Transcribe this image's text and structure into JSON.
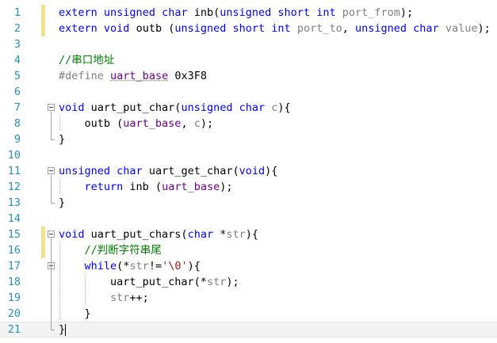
{
  "editor": {
    "language": "C",
    "current_line": 21,
    "lines": [
      {
        "n": "1",
        "tokens": [
          {
            "t": "extern",
            "c": "kw"
          },
          {
            "t": " ",
            "c": ""
          },
          {
            "t": "unsigned",
            "c": "kw"
          },
          {
            "t": " ",
            "c": ""
          },
          {
            "t": "char",
            "c": "kw"
          },
          {
            "t": " inb(",
            "c": ""
          },
          {
            "t": "unsigned",
            "c": "kw"
          },
          {
            "t": " ",
            "c": ""
          },
          {
            "t": "short",
            "c": "kw"
          },
          {
            "t": " ",
            "c": ""
          },
          {
            "t": "int",
            "c": "kw"
          },
          {
            "t": " ",
            "c": ""
          },
          {
            "t": "port_from",
            "c": "pm"
          },
          {
            "t": ");",
            "c": ""
          }
        ]
      },
      {
        "n": "2",
        "tokens": [
          {
            "t": "extern",
            "c": "kw"
          },
          {
            "t": " ",
            "c": ""
          },
          {
            "t": "void",
            "c": "kw"
          },
          {
            "t": " outb (",
            "c": ""
          },
          {
            "t": "unsigned",
            "c": "kw"
          },
          {
            "t": " ",
            "c": ""
          },
          {
            "t": "short",
            "c": "kw"
          },
          {
            "t": " ",
            "c": ""
          },
          {
            "t": "int",
            "c": "kw"
          },
          {
            "t": " ",
            "c": ""
          },
          {
            "t": "port_to",
            "c": "pm"
          },
          {
            "t": ", ",
            "c": ""
          },
          {
            "t": "unsigned",
            "c": "kw"
          },
          {
            "t": " ",
            "c": ""
          },
          {
            "t": "char",
            "c": "kw"
          },
          {
            "t": " ",
            "c": ""
          },
          {
            "t": "value",
            "c": "pm"
          },
          {
            "t": ");",
            "c": ""
          }
        ]
      },
      {
        "n": "3",
        "tokens": []
      },
      {
        "n": "4",
        "tokens": [
          {
            "t": "//串口地址",
            "c": "cm"
          }
        ]
      },
      {
        "n": "5",
        "tokens": [
          {
            "t": "#define",
            "c": "pp"
          },
          {
            "t": " ",
            "c": ""
          },
          {
            "t": "uart_base",
            "c": "mac squig"
          },
          {
            "t": " 0x3F8",
            "c": ""
          }
        ]
      },
      {
        "n": "6",
        "tokens": []
      },
      {
        "n": "7",
        "tokens": [
          {
            "t": "void",
            "c": "kw"
          },
          {
            "t": " uart_put_char(",
            "c": ""
          },
          {
            "t": "unsigned",
            "c": "kw"
          },
          {
            "t": " ",
            "c": ""
          },
          {
            "t": "char",
            "c": "kw"
          },
          {
            "t": " ",
            "c": ""
          },
          {
            "t": "c",
            "c": "pm"
          },
          {
            "t": "){",
            "c": ""
          }
        ]
      },
      {
        "n": "8",
        "tokens": [
          {
            "t": "    outb (",
            "c": ""
          },
          {
            "t": "uart_base",
            "c": "mac"
          },
          {
            "t": ", ",
            "c": ""
          },
          {
            "t": "c",
            "c": "pm"
          },
          {
            "t": ");",
            "c": ""
          }
        ]
      },
      {
        "n": "9",
        "tokens": [
          {
            "t": "}",
            "c": ""
          }
        ]
      },
      {
        "n": "10",
        "tokens": []
      },
      {
        "n": "11",
        "tokens": [
          {
            "t": "unsigned",
            "c": "kw"
          },
          {
            "t": " ",
            "c": ""
          },
          {
            "t": "char",
            "c": "kw"
          },
          {
            "t": " uart_get_char(",
            "c": ""
          },
          {
            "t": "void",
            "c": "kw"
          },
          {
            "t": "){",
            "c": ""
          }
        ]
      },
      {
        "n": "12",
        "tokens": [
          {
            "t": "    ",
            "c": ""
          },
          {
            "t": "return",
            "c": "kw"
          },
          {
            "t": " inb (",
            "c": ""
          },
          {
            "t": "uart_base",
            "c": "mac"
          },
          {
            "t": ");",
            "c": ""
          }
        ]
      },
      {
        "n": "13",
        "tokens": [
          {
            "t": "}",
            "c": ""
          }
        ]
      },
      {
        "n": "14",
        "tokens": []
      },
      {
        "n": "15",
        "tokens": [
          {
            "t": "void",
            "c": "kw"
          },
          {
            "t": " uart_put_chars(",
            "c": ""
          },
          {
            "t": "char",
            "c": "kw"
          },
          {
            "t": " *",
            "c": ""
          },
          {
            "t": "str",
            "c": "pm"
          },
          {
            "t": "){",
            "c": ""
          }
        ]
      },
      {
        "n": "16",
        "tokens": [
          {
            "t": "    ",
            "c": ""
          },
          {
            "t": "//判断字符串尾",
            "c": "cm"
          }
        ]
      },
      {
        "n": "17",
        "tokens": [
          {
            "t": "    ",
            "c": ""
          },
          {
            "t": "while",
            "c": "kw"
          },
          {
            "t": "(*",
            "c": ""
          },
          {
            "t": "str",
            "c": "pm"
          },
          {
            "t": "!=",
            "c": ""
          },
          {
            "t": "'\\0'",
            "c": "st"
          },
          {
            "t": "){",
            "c": ""
          }
        ]
      },
      {
        "n": "18",
        "tokens": [
          {
            "t": "        uart_put_char(*",
            "c": ""
          },
          {
            "t": "str",
            "c": "pm"
          },
          {
            "t": ");",
            "c": ""
          }
        ]
      },
      {
        "n": "19",
        "tokens": [
          {
            "t": "        ",
            "c": ""
          },
          {
            "t": "str",
            "c": "pm"
          },
          {
            "t": "++;",
            "c": ""
          }
        ]
      },
      {
        "n": "20",
        "tokens": [
          {
            "t": "    }",
            "c": ""
          }
        ]
      },
      {
        "n": "21",
        "tokens": [
          {
            "t": "}",
            "c": ""
          }
        ]
      }
    ]
  }
}
